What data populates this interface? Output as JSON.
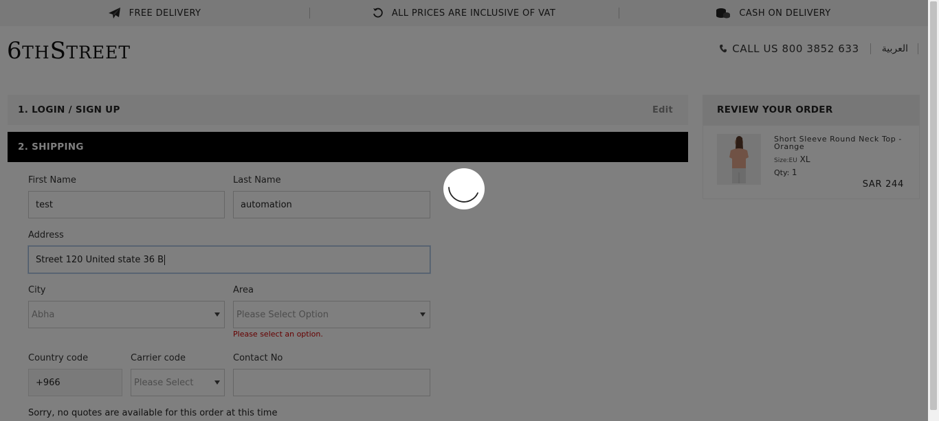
{
  "topbar": {
    "items": [
      {
        "label": "FREE DELIVERY",
        "icon": "paper-plane-icon"
      },
      {
        "label": "ALL PRICES ARE INCLUSIVE OF VAT",
        "icon": "refresh-icon"
      },
      {
        "label": "CASH ON DELIVERY",
        "icon": "coins-icon"
      }
    ]
  },
  "header": {
    "logo": {
      "big1": "6",
      "small1": "TH",
      "big2": "S",
      "small2": "TREET"
    },
    "call": "CALL US 800 3852 633",
    "language": "العربية"
  },
  "checkout": {
    "step1": {
      "title": "1. LOGIN / SIGN UP",
      "edit": "Edit"
    },
    "step2": {
      "title": "2. SHIPPING"
    },
    "form": {
      "first_name": {
        "label": "First Name",
        "value": "test"
      },
      "last_name": {
        "label": "Last Name",
        "value": "automation"
      },
      "address": {
        "label": "Address",
        "value": "Street 120 United state 36 B"
      },
      "city": {
        "label": "City",
        "value": "Abha"
      },
      "area": {
        "label": "Area",
        "value": "Please Select Option",
        "error": "Please select an option."
      },
      "country_code": {
        "label": "Country code",
        "value": "+966"
      },
      "carrier_code": {
        "label": "Carrier code",
        "value": "Please Select"
      },
      "contact_no": {
        "label": "Contact No",
        "value": ""
      },
      "note": "Sorry, no quotes are available for this order at this time"
    }
  },
  "review": {
    "title": "REVIEW YOUR ORDER",
    "item": {
      "name": "Short Sleeve Round Neck Top - Orange",
      "size_label": "Size:EU",
      "size_value": "XL",
      "qty_label": "Qty:",
      "qty_value": "1",
      "price": "SAR 244"
    }
  },
  "colors": {
    "overlay": "rgba(0,0,0,0.5)",
    "active_step": "#000000",
    "error": "#cc0000",
    "product": "#e0a58a"
  }
}
